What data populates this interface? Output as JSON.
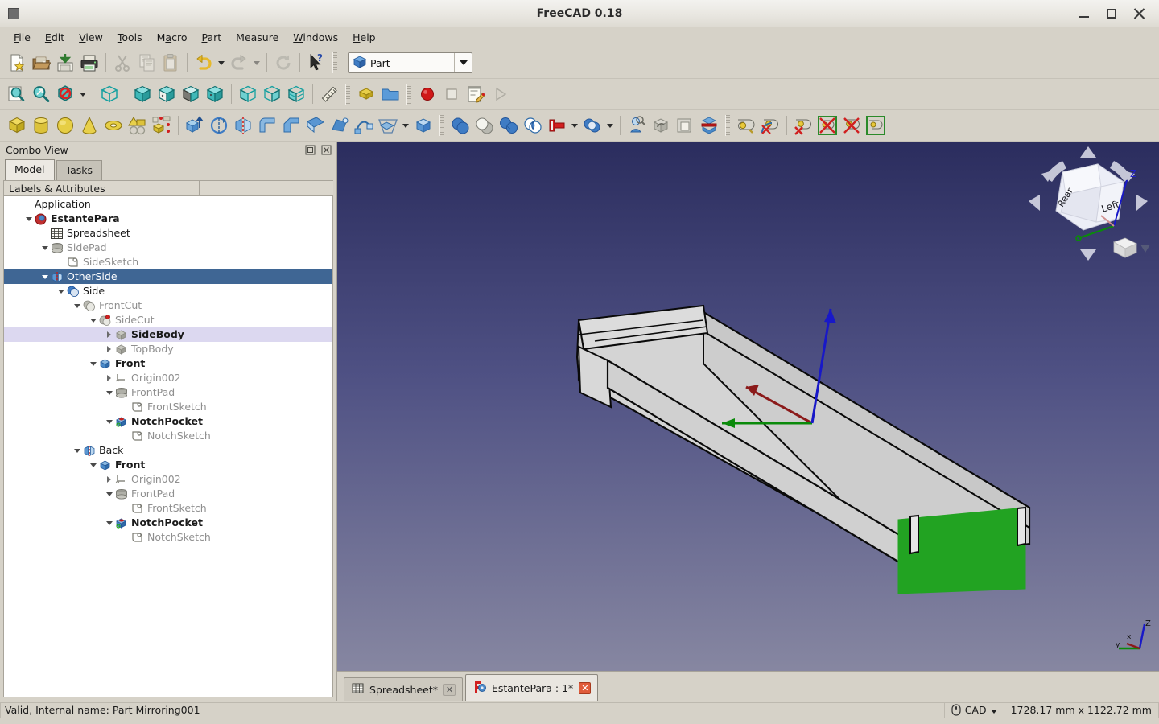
{
  "window": {
    "title": "FreeCAD 0.18",
    "app_icon": "freecad-window-icon",
    "minimize_label": "Minimize",
    "maximize_label": "Maximize",
    "close_label": "Close"
  },
  "menubar": {
    "items": [
      {
        "label": "File",
        "mnemonic": "F"
      },
      {
        "label": "Edit",
        "mnemonic": "E"
      },
      {
        "label": "View",
        "mnemonic": "V"
      },
      {
        "label": "Tools",
        "mnemonic": "T"
      },
      {
        "label": "Macro",
        "mnemonic": "M"
      },
      {
        "label": "Part",
        "mnemonic": "P"
      },
      {
        "label": "Measure",
        "mnemonic": ""
      },
      {
        "label": "Windows",
        "mnemonic": "W"
      },
      {
        "label": "Help",
        "mnemonic": "H"
      }
    ]
  },
  "toolbars": {
    "file": [
      {
        "name": "new-document-button",
        "icon": "new-document-icon",
        "enabled": true
      },
      {
        "name": "open-document-button",
        "icon": "open-folder-icon",
        "enabled": true
      },
      {
        "name": "save-document-button",
        "icon": "save-icon",
        "enabled": true
      },
      {
        "name": "print-button",
        "icon": "printer-icon",
        "enabled": true
      },
      {
        "name": "cut-button",
        "icon": "scissors-icon",
        "enabled": false
      },
      {
        "name": "copy-button",
        "icon": "copy-icon",
        "enabled": false
      },
      {
        "name": "paste-button",
        "icon": "clipboard-icon",
        "enabled": false
      },
      {
        "name": "undo-button",
        "icon": "undo-arrow-icon",
        "enabled": true
      },
      {
        "name": "redo-button",
        "icon": "redo-arrow-icon",
        "enabled": false
      },
      {
        "name": "refresh-button",
        "icon": "refresh-icon",
        "enabled": false
      },
      {
        "name": "whats-this-button",
        "icon": "cursor-question-icon",
        "enabled": true
      }
    ],
    "workbench": {
      "selected": "Part",
      "icon": "part-workbench-icon"
    },
    "view": [
      {
        "name": "fit-all-button",
        "icon": "fit-all-icon"
      },
      {
        "name": "fit-selection-button",
        "icon": "zoom-selection-icon"
      },
      {
        "name": "draw-style-button",
        "icon": "draw-style-icon"
      },
      {
        "name": "axonometric-view-button",
        "icon": "isometric-cube-icon"
      },
      {
        "name": "front-view-button",
        "icon": "view-front-icon"
      },
      {
        "name": "top-view-button",
        "icon": "view-top-icon"
      },
      {
        "name": "right-view-button",
        "icon": "view-right-icon"
      },
      {
        "name": "rear-view-button",
        "icon": "view-rear-icon"
      },
      {
        "name": "bottom-view-button",
        "icon": "view-bottom-icon"
      },
      {
        "name": "left-view-button",
        "icon": "view-left-icon"
      },
      {
        "name": "measure-distance-button",
        "icon": "ruler-icon"
      },
      {
        "name": "workbench-std-button",
        "icon": "yellow-blocks-icon"
      },
      {
        "name": "group-button",
        "icon": "blue-folder-icon"
      },
      {
        "name": "macro-record-button",
        "icon": "record-red-dot-icon"
      },
      {
        "name": "macro-stop-button",
        "icon": "stop-square-icon"
      },
      {
        "name": "macro-edit-button",
        "icon": "macro-edit-icon"
      },
      {
        "name": "macro-execute-button",
        "icon": "play-triangle-icon"
      }
    ],
    "part": [
      {
        "name": "box-primitive-button",
        "icon": "yellow-box-icon"
      },
      {
        "name": "cylinder-primitive-button",
        "icon": "yellow-cylinder-icon"
      },
      {
        "name": "sphere-primitive-button",
        "icon": "yellow-sphere-icon"
      },
      {
        "name": "cone-primitive-button",
        "icon": "yellow-cone-icon"
      },
      {
        "name": "torus-primitive-button",
        "icon": "yellow-torus-icon"
      },
      {
        "name": "create-primitives-button",
        "icon": "create-primitives-icon"
      },
      {
        "name": "shape-builder-button",
        "icon": "shape-builder-icon"
      },
      {
        "name": "extrude-button",
        "icon": "extrude-icon"
      },
      {
        "name": "revolve-button",
        "icon": "revolve-icon"
      },
      {
        "name": "mirror-button",
        "icon": "mirror-icon"
      },
      {
        "name": "fillet-button",
        "icon": "fillet-icon"
      },
      {
        "name": "chamfer-button",
        "icon": "chamfer-icon"
      },
      {
        "name": "ruled-surface-button",
        "icon": "ruled-surface-icon"
      },
      {
        "name": "loft-button",
        "icon": "loft-icon"
      },
      {
        "name": "sweep-button",
        "icon": "sweep-icon"
      },
      {
        "name": "section-button",
        "icon": "section-icon"
      },
      {
        "name": "cross-sections-button",
        "icon": "cross-sections-icon"
      },
      {
        "name": "boolean-button",
        "icon": "boolean-icon"
      },
      {
        "name": "cut-boolean-button",
        "icon": "cut-boolean-icon"
      },
      {
        "name": "union-button",
        "icon": "union-icon"
      },
      {
        "name": "intersection-button",
        "icon": "intersection-icon"
      },
      {
        "name": "join-connect-button",
        "icon": "join-connect-icon"
      },
      {
        "name": "split-boolean-button",
        "icon": "split-boolean-icon"
      },
      {
        "name": "check-geometry-button",
        "icon": "check-geometry-icon"
      },
      {
        "name": "defeaturing-button",
        "icon": "defeaturing-icon"
      },
      {
        "name": "thickness-button",
        "icon": "thickness-icon"
      },
      {
        "name": "compound-tools-button",
        "icon": "compound-icon"
      },
      {
        "name": "measure-linear-button",
        "icon": "measure-linear-icon"
      },
      {
        "name": "measure-angular-button",
        "icon": "measure-angular-icon"
      },
      {
        "name": "measure-refresh-button",
        "icon": "measure-refresh-icon"
      },
      {
        "name": "measure-clear-all-button",
        "icon": "measure-clear-icon"
      },
      {
        "name": "measure-toggle-all-button",
        "icon": "measure-toggle-icon"
      },
      {
        "name": "measure-toggle-delta-button",
        "icon": "measure-delta-icon"
      }
    ]
  },
  "combo_view": {
    "title": "Combo View",
    "float_button_label": "Float",
    "close_button_label": "Close",
    "tabs": [
      {
        "label": "Model",
        "active": true
      },
      {
        "label": "Tasks",
        "active": false
      }
    ],
    "tree_column_header": "Labels & Attributes",
    "tree": [
      {
        "label": "Application",
        "depth": 0,
        "arrow": "none",
        "icon": "",
        "state": "normal",
        "bold": false
      },
      {
        "label": "EstantePara",
        "depth": 1,
        "arrow": "down",
        "icon": "document-icon",
        "state": "normal",
        "bold": true
      },
      {
        "label": "Spreadsheet",
        "depth": 2,
        "arrow": "none",
        "icon": "spreadsheet-icon",
        "state": "normal",
        "bold": false
      },
      {
        "label": "SidePad",
        "depth": 2,
        "arrow": "down",
        "icon": "pad-icon",
        "state": "greyed",
        "bold": false
      },
      {
        "label": "SideSketch",
        "depth": 3,
        "arrow": "none",
        "icon": "sketch-icon",
        "state": "greyed",
        "bold": false
      },
      {
        "label": "OtherSide",
        "depth": 2,
        "arrow": "down",
        "icon": "mirror-icon",
        "state": "selected",
        "bold": false
      },
      {
        "label": "Side",
        "depth": 3,
        "arrow": "down",
        "icon": "boolean-blue-icon",
        "state": "normal",
        "bold": false
      },
      {
        "label": "FrontCut",
        "depth": 4,
        "arrow": "down",
        "icon": "boolean-grey-icon",
        "state": "greyed",
        "bold": false
      },
      {
        "label": "SideCut",
        "depth": 5,
        "arrow": "down",
        "icon": "cut-marker-icon",
        "state": "greyed",
        "bold": false
      },
      {
        "label": "SideBody",
        "depth": 6,
        "arrow": "right",
        "icon": "body-icon",
        "state": "highlight",
        "bold": true
      },
      {
        "label": "TopBody",
        "depth": 6,
        "arrow": "right",
        "icon": "body-icon",
        "state": "greyed",
        "bold": false
      },
      {
        "label": "Front",
        "depth": 5,
        "arrow": "down",
        "icon": "body-blue-icon",
        "state": "normal",
        "bold": true
      },
      {
        "label": "Origin002",
        "depth": 6,
        "arrow": "right",
        "icon": "origin-icon",
        "state": "greyed",
        "bold": false
      },
      {
        "label": "FrontPad",
        "depth": 6,
        "arrow": "down",
        "icon": "pad-icon",
        "state": "greyed",
        "bold": false
      },
      {
        "label": "FrontSketch",
        "depth": 7,
        "arrow": "none",
        "icon": "sketch-icon",
        "state": "greyed",
        "bold": false
      },
      {
        "label": "NotchPocket",
        "depth": 6,
        "arrow": "down",
        "icon": "pocket-icon",
        "state": "normal",
        "bold": true
      },
      {
        "label": "NotchSketch",
        "depth": 7,
        "arrow": "none",
        "icon": "sketch-icon",
        "state": "greyed",
        "bold": false
      },
      {
        "label": "Back",
        "depth": 4,
        "arrow": "down",
        "icon": "mirror-icon",
        "state": "normal",
        "bold": false
      },
      {
        "label": "Front",
        "depth": 5,
        "arrow": "down",
        "icon": "body-blue-icon",
        "state": "normal",
        "bold": true
      },
      {
        "label": "Origin002",
        "depth": 6,
        "arrow": "right",
        "icon": "origin-icon",
        "state": "greyed",
        "bold": false
      },
      {
        "label": "FrontPad",
        "depth": 6,
        "arrow": "down",
        "icon": "pad-icon",
        "state": "greyed",
        "bold": false
      },
      {
        "label": "FrontSketch",
        "depth": 7,
        "arrow": "none",
        "icon": "sketch-icon",
        "state": "greyed",
        "bold": false
      },
      {
        "label": "NotchPocket",
        "depth": 6,
        "arrow": "down",
        "icon": "pocket-icon",
        "state": "normal",
        "bold": true
      },
      {
        "label": "NotchSketch",
        "depth": 7,
        "arrow": "none",
        "icon": "sketch-icon",
        "state": "greyed",
        "bold": false
      }
    ]
  },
  "view3d": {
    "nav_cube": {
      "face_front_label": "Rear",
      "face_right_label": "Left",
      "axis_z_label": "Z"
    },
    "axis_cross": {
      "x_label": "x",
      "y_label": "y",
      "z_label": "Z"
    },
    "selected_face_color": "#22a322",
    "model_face_color": "#d2d2d2",
    "tabs": [
      {
        "label": "Spreadsheet*",
        "icon": "spreadsheet-icon",
        "active": false
      },
      {
        "label": "EstantePara : 1*",
        "icon": "freecad-doc-icon",
        "active": true
      }
    ]
  },
  "statusbar": {
    "message": "Valid, Internal name: Part   Mirroring001",
    "nav_style": "CAD",
    "nav_icon": "mouse-icon",
    "dimensions": "1728.17 mm x 1122.72 mm"
  }
}
